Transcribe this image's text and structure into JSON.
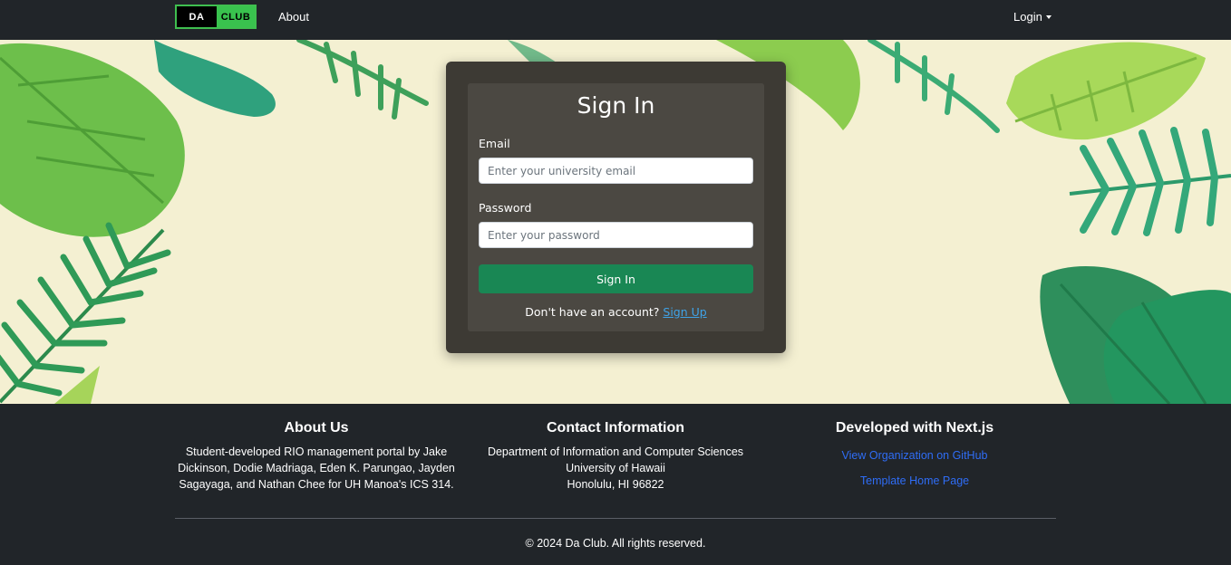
{
  "navbar": {
    "logo_left": "DA",
    "logo_right": "CLUB",
    "about_label": "About",
    "login_label": "Login"
  },
  "signin": {
    "title": "Sign In",
    "email_label": "Email",
    "email_placeholder": "Enter your university email",
    "password_label": "Password",
    "password_placeholder": "Enter your password",
    "submit_label": "Sign In",
    "no_account_text": "Don't have an account?",
    "signup_link": "Sign Up"
  },
  "footer": {
    "about": {
      "heading": "About Us",
      "text": "Student-developed RIO management portal by Jake Dickinson, Dodie Madriaga, Eden K. Parungao, Jayden Sagayaga, and Nathan Chee for UH Manoa's ICS 314."
    },
    "contact": {
      "heading": "Contact Information",
      "line1": "Department of Information and Computer Sciences",
      "line2": "University of Hawaii",
      "line3": "Honolulu, HI 96822"
    },
    "developed": {
      "heading": "Developed with Next.js",
      "link1": "View Organization on GitHub",
      "link2": "Template Home Page"
    },
    "copyright": "© 2024 Da Club. All rights reserved."
  },
  "colors": {
    "navbar_bg": "#212529",
    "hero_bg": "#f4f0d2",
    "card_bg": "#3d3a34",
    "signin_button": "#198754",
    "footer_link": "#2f6df6",
    "logo_green": "#39c24e"
  }
}
